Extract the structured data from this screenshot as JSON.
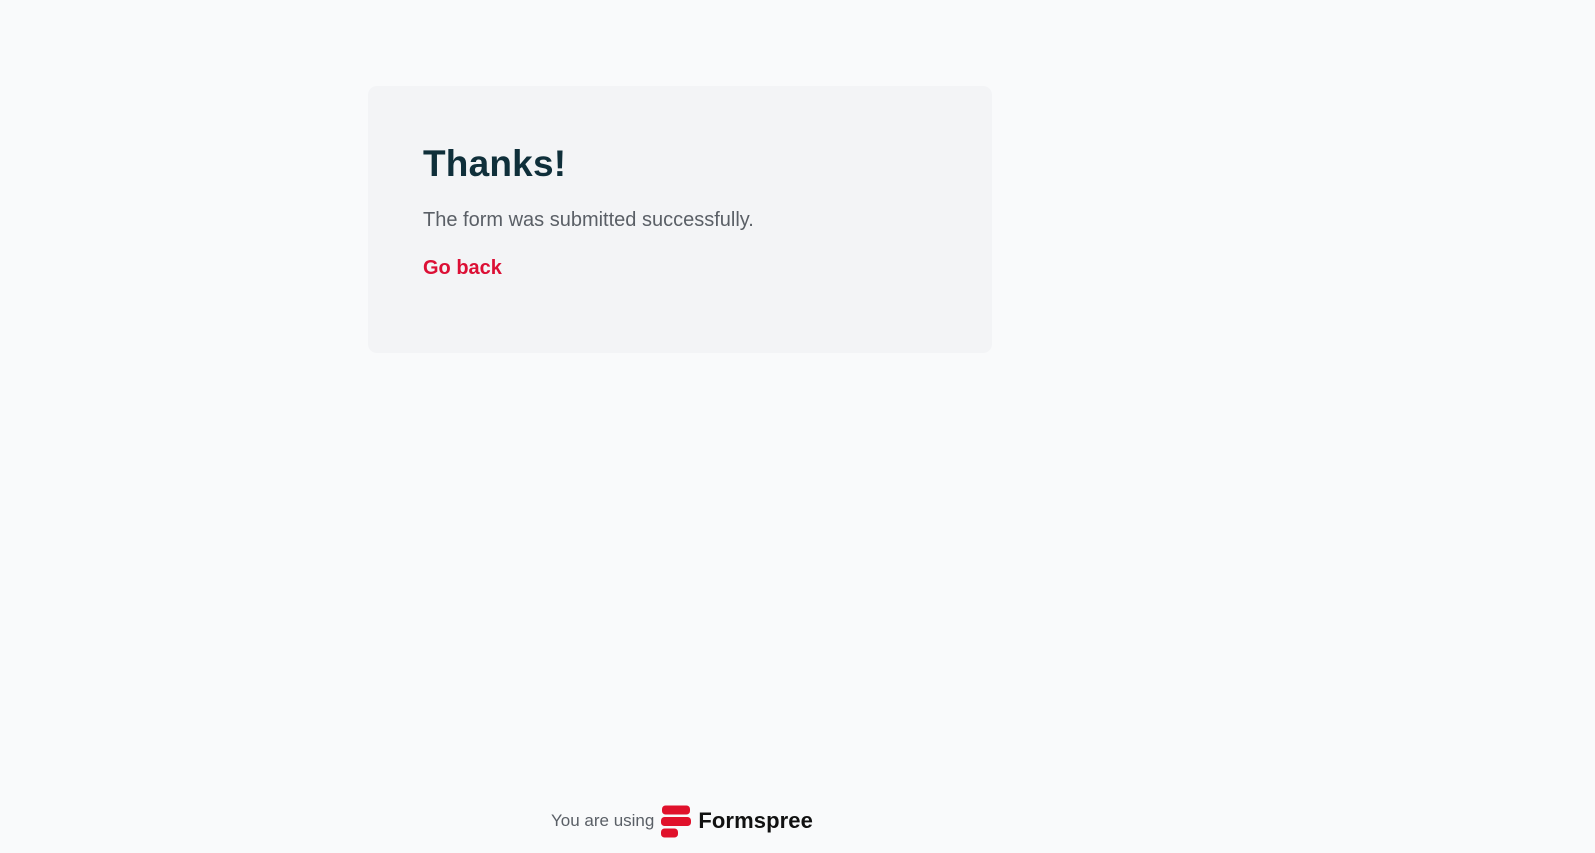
{
  "card": {
    "title": "Thanks!",
    "message": "The form was submitted successfully.",
    "back_link_label": "Go back"
  },
  "footer": {
    "using_text": "You are using",
    "brand_name": "Formspree",
    "logo_icon": "formspree-logo-icon"
  },
  "colors": {
    "page_background": "#f9fafb",
    "card_background": "#f3f4f6",
    "title": "#0f2f3a",
    "message": "#5a5f66",
    "link": "#dc0f35",
    "brand_red": "#e0112b"
  }
}
